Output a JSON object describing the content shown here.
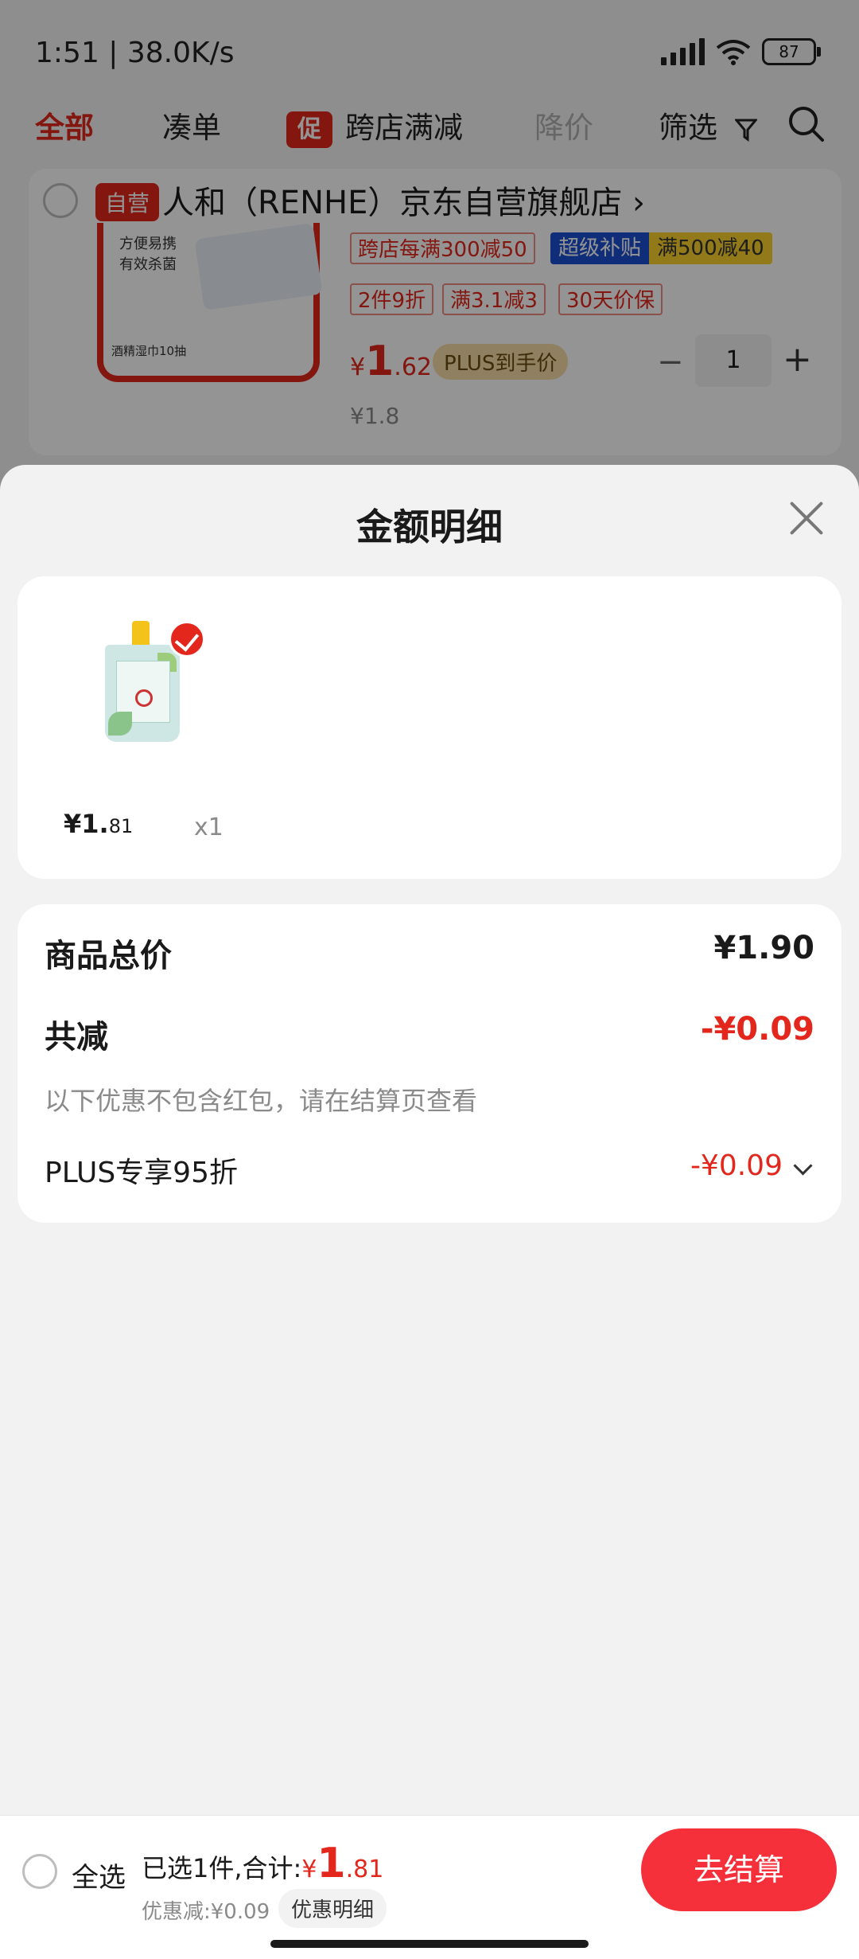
{
  "status_bar": {
    "time": "1:51 | 38.0K/s",
    "battery": "87"
  },
  "tabs": {
    "all": "全部",
    "bundle": "凑单",
    "promo_badge": "促",
    "cross_store": "跨店满减",
    "price_drop": "降价",
    "filter": "筛选"
  },
  "cart_item": {
    "store_tag": "自营",
    "store_name": "人和（RENHE）京东自营旗舰店 ›",
    "thumb_text": "方便易携\n有效杀菌",
    "thumb_caption": "酒精湿巾10抽",
    "promo_tags": [
      "跨店每满300减50",
      "2件9折",
      "满3.1减3",
      "30天价保"
    ],
    "subsidy_left": "超级补贴",
    "subsidy_right": "满500减40",
    "price_currency": "¥",
    "price_int": "1",
    "price_dec": ".62",
    "plus_price_label": "PLUS到手价",
    "old_price": "¥1.8",
    "quantity": "1",
    "minus": "−",
    "plus": "+"
  },
  "sheet": {
    "title": "金额明细",
    "product": {
      "price_int": "¥1.",
      "price_dec": "81",
      "quantity": "x1"
    },
    "summary": {
      "total_label": "商品总价",
      "total_value": "¥1.90",
      "reduction_label": "共减",
      "reduction_value": "-¥0.09",
      "note": "以下优惠不包含红包，请在结算页查看",
      "plus_label": "PLUS专享95折",
      "plus_value": "-¥0.09"
    }
  },
  "bottom_bar": {
    "select_all": "全选",
    "selected_prefix": "已选1件,合计:",
    "total_currency": "¥",
    "total_int": "1",
    "total_dec": ".81",
    "discount": "优惠减:¥0.09",
    "detail_chip": "优惠明细",
    "checkout": "去结算"
  },
  "colors": {
    "accent": "#e4271c",
    "checkout": "#f5303a",
    "subsidy_blue": "#1c4fd1",
    "subsidy_yellow": "#fcd22d"
  }
}
